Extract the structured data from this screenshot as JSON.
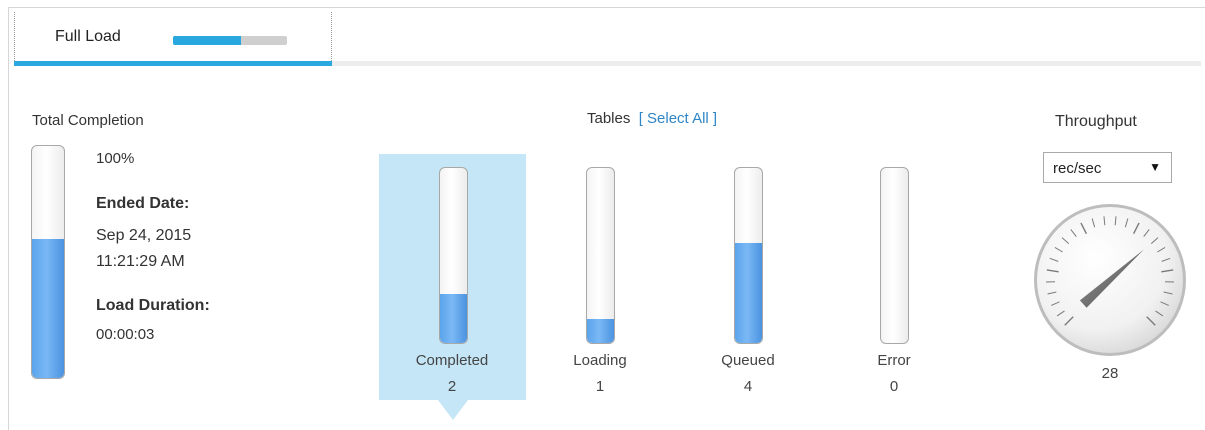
{
  "tab": {
    "label": "Full Load",
    "progress_fraction": 0.6
  },
  "total_completion": {
    "title": "Total Completion",
    "percent_text": "100%",
    "bar_fill_fraction": 0.6,
    "ended_date_label": "Ended Date:",
    "ended_date": "Sep 24, 2015",
    "ended_time": "11:21:29 AM",
    "load_duration_label": "Load Duration:",
    "load_duration": "00:00:03"
  },
  "tables": {
    "title": "Tables",
    "select_all": "[ Select All ]",
    "categories": [
      {
        "label": "Completed",
        "count": "2",
        "fill_fraction": 0.28,
        "selected": true
      },
      {
        "label": "Loading",
        "count": "1",
        "fill_fraction": 0.14,
        "selected": false
      },
      {
        "label": "Queued",
        "count": "4",
        "fill_fraction": 0.57,
        "selected": false
      },
      {
        "label": "Error",
        "count": "0",
        "fill_fraction": 0.0,
        "selected": false
      }
    ]
  },
  "throughput": {
    "title": "Throughput",
    "unit_selected": "rec/sec",
    "dropdown_icon": "triangle-down",
    "value": "28"
  },
  "colors": {
    "accent": "#2aa8df",
    "bar_fill": "#5aa4ec",
    "selected_bg": "#c4e6f6",
    "link": "#2f86c7"
  }
}
